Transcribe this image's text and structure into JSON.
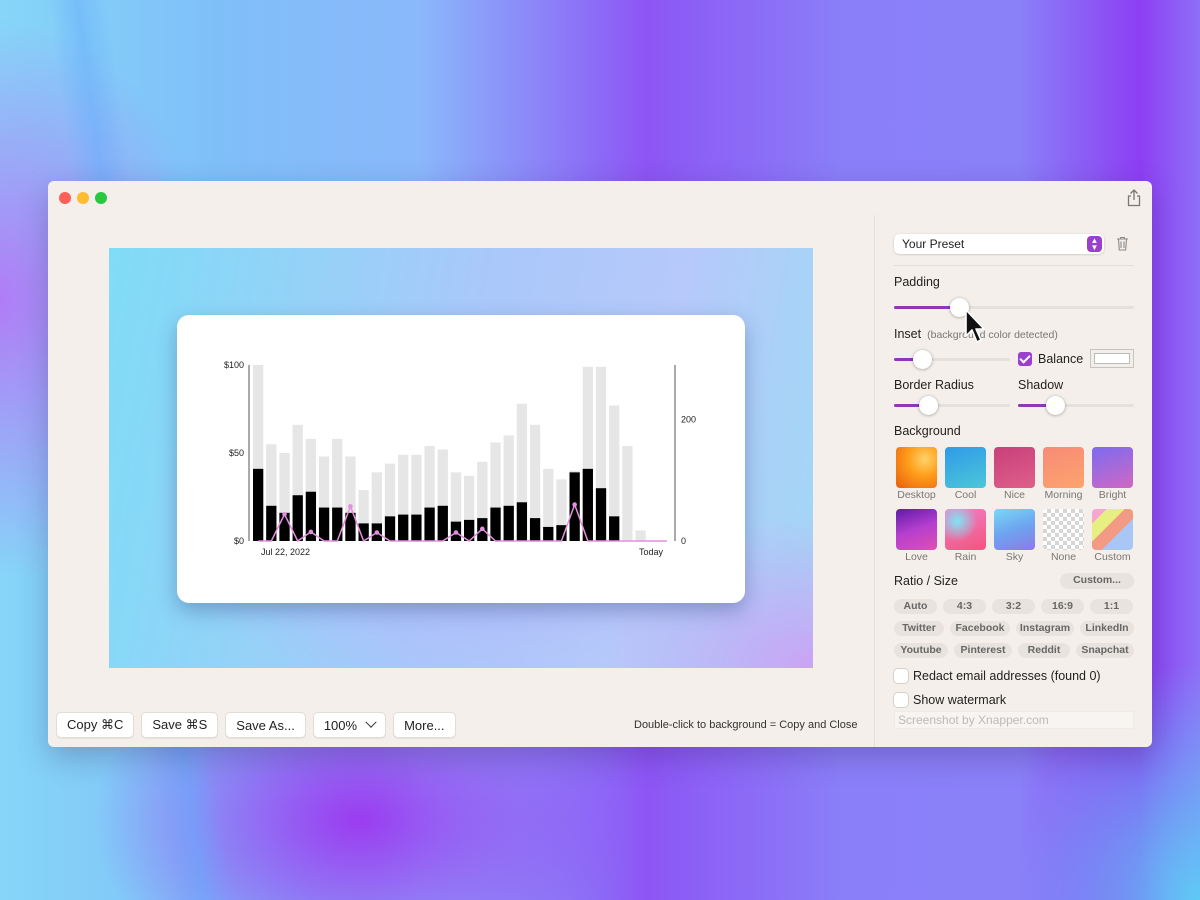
{
  "window": {
    "traffic_lights": [
      "close",
      "minimize",
      "zoom"
    ],
    "share_icon": "share-icon"
  },
  "preview": {
    "chart_data": {
      "type": "bar",
      "title": "",
      "xlabel": "",
      "ylabel": "",
      "x_tick_labels": [
        "Jul 22, 2022",
        "Today"
      ],
      "y_left": {
        "ticks": [
          "$0",
          "$50",
          "$100"
        ],
        "range": [
          0,
          100
        ]
      },
      "y_right": {
        "ticks": [
          "0",
          "200"
        ],
        "range": [
          0,
          290
        ]
      },
      "series": [
        {
          "name": "total",
          "color": "#e6e6e6",
          "axis": "left",
          "type": "bar",
          "values": [
            100,
            55,
            50,
            66,
            58,
            48,
            58,
            48,
            29,
            39,
            44,
            49,
            49,
            54,
            52,
            39,
            37,
            45,
            56,
            60,
            78,
            66,
            41,
            35,
            40,
            99,
            99,
            77,
            54,
            6,
            0,
            0
          ]
        },
        {
          "name": "part",
          "color": "#000000",
          "axis": "left",
          "type": "bar",
          "values": [
            41,
            20,
            16,
            26,
            28,
            19,
            19,
            16,
            10,
            10,
            14,
            15,
            15,
            19,
            20,
            11,
            12,
            13,
            19,
            20,
            22,
            13,
            8,
            9,
            39,
            41,
            30,
            14,
            0,
            0,
            0,
            0
          ]
        },
        {
          "name": "count",
          "color": "#e48ee0",
          "axis": "right",
          "type": "line",
          "values": [
            0,
            0,
            44,
            0,
            15,
            0,
            0,
            57,
            0,
            14,
            0,
            0,
            0,
            0,
            0,
            14,
            0,
            20,
            0,
            0,
            0,
            0,
            0,
            0,
            60,
            0,
            0,
            0,
            0,
            0,
            0,
            0
          ]
        }
      ]
    }
  },
  "toolbar": {
    "copy": "Copy ⌘C",
    "save": "Save ⌘S",
    "save_as": "Save As...",
    "zoom": "100%",
    "more": "More...",
    "hint": "Double-click to background = Copy and Close"
  },
  "sidebar": {
    "preset": "Your Preset",
    "padding_label": "Padding",
    "padding_value": 0.27,
    "inset_label": "Inset",
    "inset_sublabel": "(background color detected)",
    "inset_value": 0.24,
    "balance_label": "Balance",
    "balance_checked": true,
    "border_radius_label": "Border Radius",
    "border_radius_value": 0.29,
    "shadow_label": "Shadow",
    "shadow_value": 0.32,
    "background_label": "Background",
    "backgrounds": [
      "Desktop",
      "Cool",
      "Nice",
      "Morning",
      "Bright",
      "Love",
      "Rain",
      "Sky",
      "None",
      "Custom"
    ],
    "ratio_label": "Ratio / Size",
    "custom_button": "Custom...",
    "ratios": [
      "Auto",
      "4:3",
      "3:2",
      "16:9",
      "1:1"
    ],
    "socials_row1": [
      "Twitter",
      "Facebook",
      "Instagram",
      "LinkedIn"
    ],
    "socials_row2": [
      "Youtube",
      "Pinterest",
      "Reddit",
      "Snapchat"
    ],
    "redact_label": "Redact email addresses (found 0)",
    "watermark_label": "Show watermark",
    "watermark_placeholder": "Screenshot by Xnapper.com"
  }
}
